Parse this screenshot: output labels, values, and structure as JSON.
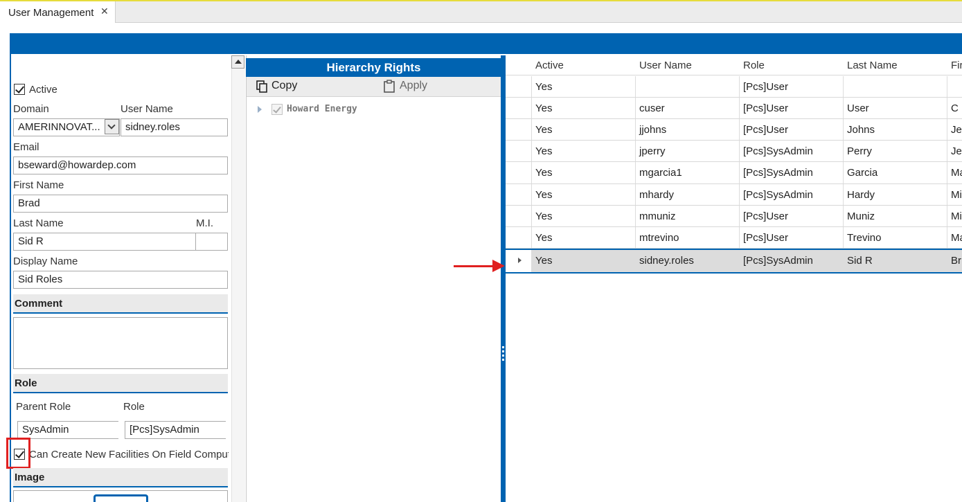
{
  "tab": {
    "title": "User Management",
    "close": "✕"
  },
  "form": {
    "active_label": "Active",
    "domain_label": "Domain",
    "domain_value": "AMERINNOVAT...",
    "username_label": "User Name",
    "username_value": "sidney.roles",
    "email_label": "Email",
    "email_value": "bseward@howardep.com",
    "firstname_label": "First Name",
    "firstname_value": "Brad",
    "lastname_label": "Last Name",
    "lastname_value": "Sid R",
    "mi_label": "M.I.",
    "mi_value": "",
    "displayname_label": "Display Name",
    "displayname_value": "Sid Roles",
    "comment_label": "Comment",
    "role_section_label": "Role",
    "parent_role_label": "Parent Role",
    "parent_role_value": "SysAdmin",
    "role_label": "Role",
    "role_value": "[Pcs]SysAdmin",
    "can_create_label": "Can Create New Facilities On Field Compute",
    "image_label": "Image"
  },
  "hierarchy": {
    "title": "Hierarchy Rights",
    "copy_label": "Copy",
    "apply_label": "Apply",
    "tree_root": "Howard Energy"
  },
  "grid": {
    "columns": [
      "Active",
      "User Name",
      "Role",
      "Last Name",
      "Fir"
    ],
    "rows": [
      [
        "Yes",
        "",
        "[Pcs]User",
        "",
        ""
      ],
      [
        "Yes",
        "cuser",
        "[Pcs]User",
        "User",
        "C"
      ],
      [
        "Yes",
        "jjohns",
        "[Pcs]User",
        "Johns",
        "Jef"
      ],
      [
        "Yes",
        "jperry",
        "[Pcs]SysAdmin",
        "Perry",
        "Jef"
      ],
      [
        "Yes",
        "mgarcia1",
        "[Pcs]SysAdmin",
        "Garcia",
        "Ma"
      ],
      [
        "Yes",
        "mhardy",
        "[Pcs]SysAdmin",
        "Hardy",
        "Mi"
      ],
      [
        "Yes",
        "mmuniz",
        "[Pcs]User",
        "Muniz",
        "Mi"
      ],
      [
        "Yes",
        "mtrevino",
        "[Pcs]User",
        "Trevino",
        "Ma"
      ],
      [
        "Yes",
        "sidney.roles",
        "[Pcs]SysAdmin",
        "Sid R",
        "Br"
      ]
    ],
    "selected_row": 8
  },
  "colors": {
    "accent": "#0063b1",
    "highlight": "#e02020"
  }
}
